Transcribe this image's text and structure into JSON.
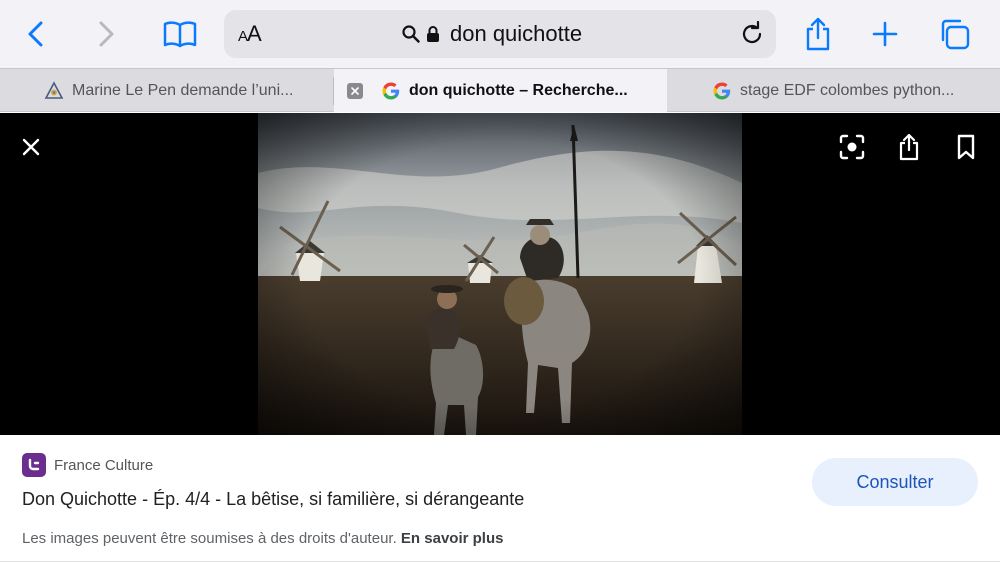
{
  "toolbar": {
    "text_size_label": "AA",
    "address": "don quichotte",
    "accent_color": "#0a7aff"
  },
  "tabs": [
    {
      "title": "Marine Le Pen demande l’uni...",
      "icon": "site-favicon",
      "active": false
    },
    {
      "title": "don quichotte – Recherche...",
      "icon": "google-g-icon",
      "active": true
    },
    {
      "title": "stage EDF colombes python...",
      "icon": "google-g-icon",
      "active": false
    }
  ],
  "viewer": {
    "image_alt": "Don Quichotte et Sancho Panza devant des moulins à vent"
  },
  "info": {
    "source_name": "France Culture",
    "source_brand_color": "#6b2d8f",
    "title": "Don Quichotte - Ép. 4/4 - La bêtise, si familière, si dérangeante",
    "copyright_text": "Les images peuvent être soumises à des droits d'auteur.",
    "learn_more": "En savoir plus",
    "consult_label": "Consulter"
  }
}
